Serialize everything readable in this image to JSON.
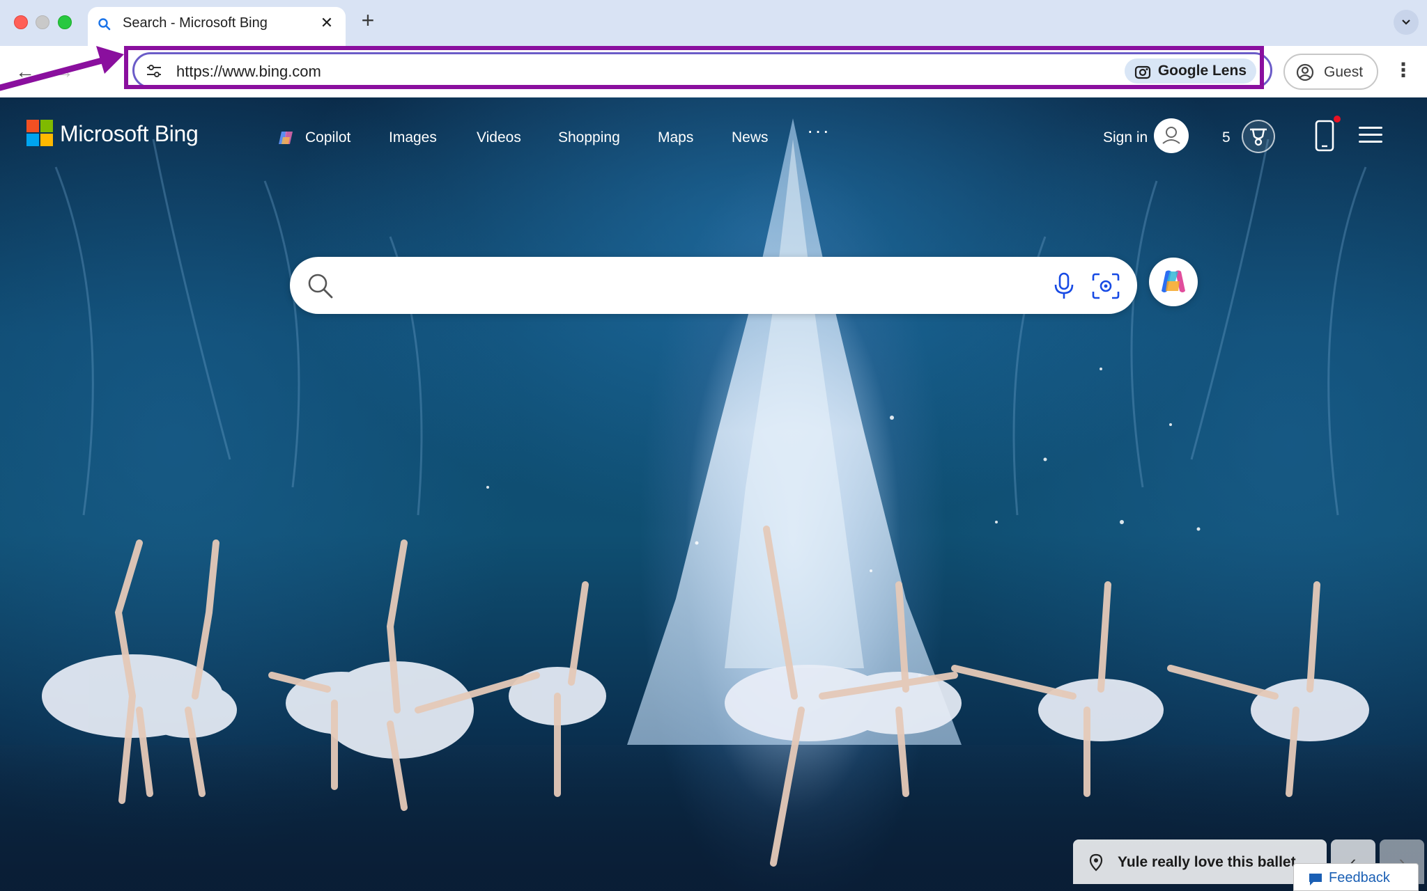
{
  "browser": {
    "tab": {
      "title": "Search - Microsoft Bing",
      "close_glyph": "✕"
    },
    "new_tab_glyph": "+",
    "tab_menu_glyph": "⌄",
    "toolbar": {
      "back_glyph": "←",
      "forward_glyph": "→",
      "url": "https://www.bing.com",
      "lens_label": "Google Lens",
      "profile_label": "Guest",
      "menu_glyph": "⋮"
    }
  },
  "bing": {
    "brand": "Microsoft Bing",
    "nav": {
      "copilot": "Copilot",
      "images": "Images",
      "videos": "Videos",
      "shopping": "Shopping",
      "maps": "Maps",
      "news": "News",
      "more": "···"
    },
    "sign_in": "Sign in",
    "rewards_count": "5",
    "search": {
      "placeholder": "",
      "value": ""
    },
    "image_info": {
      "title": "Yule really love this ballet"
    },
    "prev_glyph": "‹",
    "next_glyph": "›",
    "feedback": "Feedback"
  },
  "colors": {
    "annotation": "#8a0f9e",
    "ms_red": "#f25022",
    "ms_green": "#7fba00",
    "ms_blue": "#00a4ef",
    "ms_yellow": "#ffb900"
  },
  "icons": [
    "search-icon",
    "tune-icon",
    "google-lens-icon",
    "profile-icon",
    "copilot-icon",
    "avatar-icon",
    "trophy-icon",
    "phone-icon",
    "hamburger-icon",
    "microphone-icon",
    "visual-search-icon",
    "location-pin-icon",
    "feedback-icon"
  ]
}
